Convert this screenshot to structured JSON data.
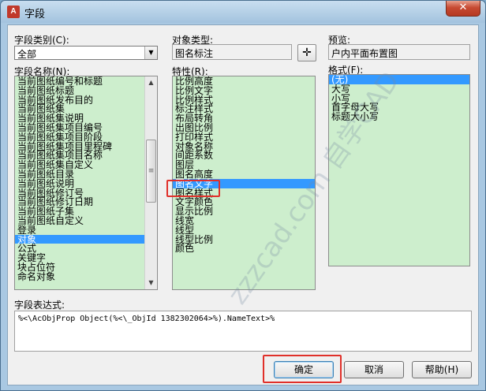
{
  "window": {
    "title": "字段",
    "close_label": "✕",
    "app_icon_glyph": "A"
  },
  "category": {
    "label": "字段类别(C):",
    "value": "全部"
  },
  "object_type": {
    "label": "对象类型:",
    "value": "图名标注"
  },
  "preview": {
    "label": "预览:",
    "value": "户内平面布置图"
  },
  "field_names": {
    "label": "字段名称(N):",
    "items": [
      "当前图纸编号和标题",
      "当前图纸标题",
      "当前图纸发布目的",
      "当前图纸集",
      "当前图纸集说明",
      "当前图纸集项目编号",
      "当前图纸集项目阶段",
      "当前图纸集项目里程碑",
      "当前图纸集项目名称",
      "当前图纸集自定义",
      "当前图纸目录",
      "当前图纸说明",
      "当前图纸修订号",
      "当前图纸修订日期",
      "当前图纸子集",
      "当前图纸自定义",
      "登录",
      "对象",
      "公式",
      "关键字",
      "块占位符",
      "命名对象"
    ],
    "selected_index": 17
  },
  "properties": {
    "label": "特性(R):",
    "items": [
      "比例高度",
      "比例文字",
      "比例样式",
      "标注样式",
      "布局转角",
      "出图比例",
      "打印样式",
      "对象名称",
      "间距系数",
      "图层",
      "图名高度",
      "图名文字",
      "图名样式",
      "文字颜色",
      "显示比例",
      "线宽",
      "线型",
      "线型比例",
      "颜色"
    ],
    "selected_index": 11
  },
  "format": {
    "label": "格式(F):",
    "items": [
      "(无)",
      "大写",
      "小写",
      "首字母大写",
      "标题大小写"
    ],
    "selected_index": 0
  },
  "expression": {
    "label": "字段表达式:",
    "value": "%<\\AcObjProp Object(%<\\_ObjId 1382302064>%).NameText>%"
  },
  "buttons": {
    "ok": "确定",
    "cancel": "取消",
    "help": "帮助(H)"
  },
  "icons": {
    "pick": "crosshair-icon",
    "dropdown": "chevron-down-icon"
  },
  "watermark": "zzzcad.com 自学CAD",
  "colors": {
    "list_bg": "#cdeecd",
    "selection": "#3399ff",
    "highlight_box": "#e0302a"
  }
}
